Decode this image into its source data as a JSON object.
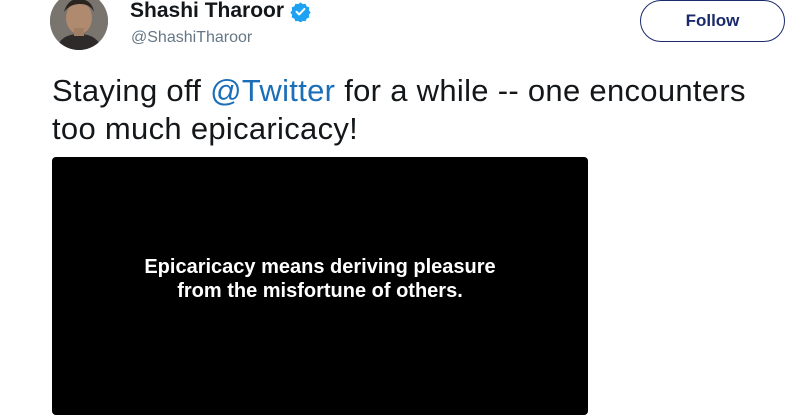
{
  "user": {
    "display_name": "Shashi Tharoor",
    "handle": "@ShashiTharoor",
    "verified": true
  },
  "follow_button": {
    "label": "Follow"
  },
  "tweet": {
    "text_before": "Staying off ",
    "mention": "@Twitter",
    "text_after": " for a while -- one encounters too much epicaricacy!"
  },
  "media": {
    "caption_line1": "Epicaricacy means deriving pleasure",
    "caption_line2": "from the misfortune of others."
  },
  "colors": {
    "link": "#1b6fb8",
    "verified_badge": "#1da1f2",
    "follow_border": "#1b2a6b",
    "handle_gray": "#657786"
  }
}
